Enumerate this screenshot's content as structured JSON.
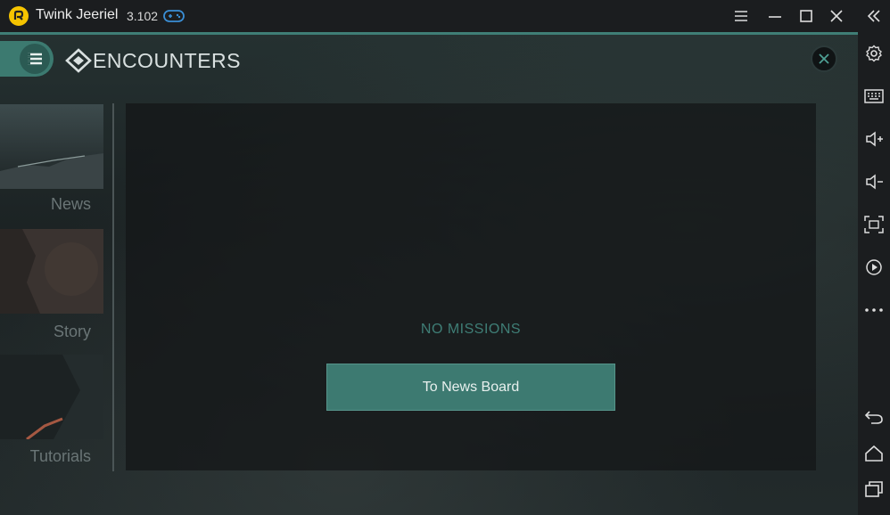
{
  "window": {
    "title": "Twink Jeeriel",
    "version": "3.102",
    "controls": [
      "menu-icon",
      "minimize-icon",
      "maximize-icon",
      "close-icon"
    ]
  },
  "sidebar": {
    "items": [
      "collapse-icon",
      "settings-icon",
      "keyboard-icon",
      "volume-up-icon",
      "volume-down-icon",
      "fullscreen-icon",
      "record-icon",
      "more-icon",
      "back-icon",
      "home-icon",
      "recent-apps-icon"
    ]
  },
  "game": {
    "title": "ENCOUNTERS",
    "categories": [
      {
        "label": "News"
      },
      {
        "label": "Story"
      },
      {
        "label": "Tutorials"
      }
    ],
    "empty_text": "NO MISSIONS",
    "news_button": "To News Board"
  },
  "colors": {
    "accent": "#3f7e76",
    "logo": "#f5c400",
    "gamepad": "#3a8fd6"
  }
}
